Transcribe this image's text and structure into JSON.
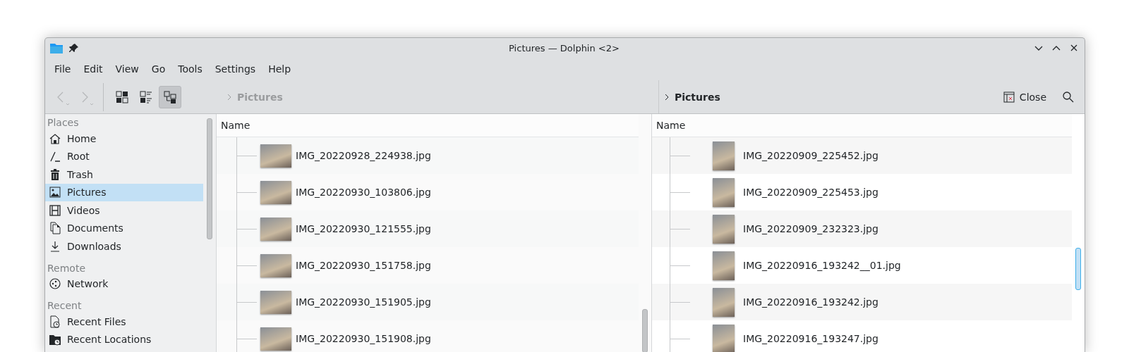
{
  "window": {
    "title": "Pictures — Dolphin <2>"
  },
  "menu": [
    "File",
    "Edit",
    "View",
    "Go",
    "Tools",
    "Settings",
    "Help"
  ],
  "navigation": [
    {
      "disabled": true
    },
    {
      "disabled": true
    }
  ],
  "view_modes": [
    {
      "selected": false
    },
    {
      "selected": false
    },
    {
      "selected": true
    }
  ],
  "sidebar": {
    "sections": [
      {
        "title": "Places",
        "items": [
          {
            "label": "Home",
            "selected": false
          },
          {
            "label": "Root",
            "selected": false
          },
          {
            "label": "Trash",
            "selected": false
          },
          {
            "label": "Pictures",
            "selected": true
          },
          {
            "label": "Videos",
            "selected": false
          },
          {
            "label": "Documents",
            "selected": false
          },
          {
            "label": "Downloads",
            "selected": false
          }
        ]
      },
      {
        "title": "Remote",
        "items": [
          {
            "label": "Network",
            "selected": false
          }
        ]
      },
      {
        "title": "Recent",
        "items": [
          {
            "label": "Recent Files",
            "selected": false
          },
          {
            "label": "Recent Locations",
            "selected": false
          }
        ]
      }
    ]
  },
  "panes": [
    {
      "active": false,
      "breadcrumb": "Pictures",
      "column": "Name",
      "rows": [
        "IMG_20220928_224938.jpg",
        "IMG_20220930_103806.jpg",
        "IMG_20220930_121555.jpg",
        "IMG_20220930_151758.jpg",
        "IMG_20220930_151905.jpg",
        "IMG_20220930_151908.jpg"
      ]
    },
    {
      "active": true,
      "breadcrumb": "Pictures",
      "close_label": "Close",
      "column": "Name",
      "rows": [
        "IMG_20220909_225452.jpg",
        "IMG_20220909_225453.jpg",
        "IMG_20220909_232323.jpg",
        "IMG_20220916_193242__01.jpg",
        "IMG_20220916_193242.jpg",
        "IMG_20220916_193247.jpg"
      ]
    }
  ]
}
